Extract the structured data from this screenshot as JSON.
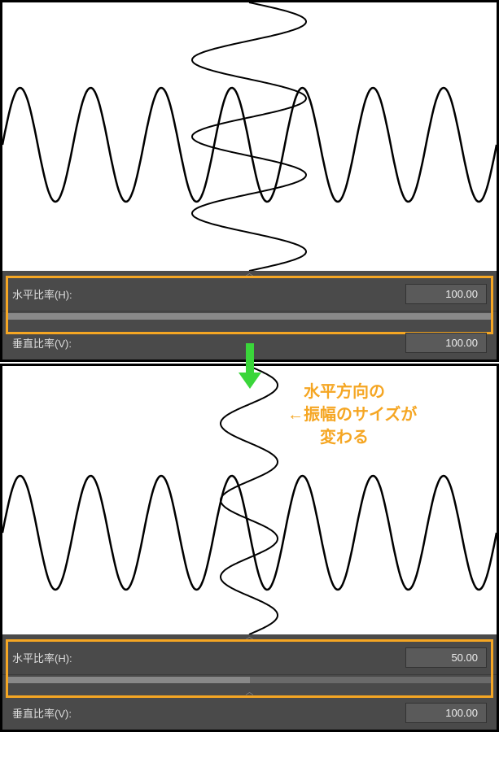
{
  "top": {
    "horizontal_label": "水平比率(H):",
    "horizontal_value": "100.00",
    "vertical_label": "垂直比率(V):",
    "vertical_value": "100.00",
    "h_amplitude": 100,
    "slider_pct": 100
  },
  "bottom": {
    "horizontal_label": "水平比率(H):",
    "horizontal_value": "50.00",
    "vertical_label": "垂直比率(V):",
    "vertical_value": "100.00",
    "h_amplitude": 50,
    "slider_pct": 50
  },
  "annotation": {
    "line1": "　水平方向の",
    "line2": "←振幅のサイズが",
    "line3": "　　変わる"
  }
}
